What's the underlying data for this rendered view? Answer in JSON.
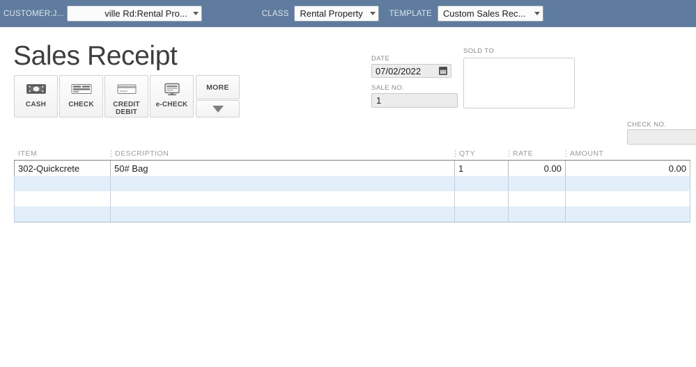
{
  "topbar": {
    "customer_label": "CUSTOMER:J...",
    "customer_value": "ville Rd:Rental Pro...",
    "class_label": "CLASS",
    "class_value": "Rental Property",
    "template_label": "TEMPLATE",
    "template_value": "Custom Sales Rec...",
    "bar_color": "#5f7c9e"
  },
  "form": {
    "title": "Sales Receipt",
    "date_label": "DATE",
    "date_value": "07/02/2022",
    "saleno_label": "SALE NO.",
    "saleno_value": "1",
    "soldto_label": "SOLD TO",
    "soldto_value": "",
    "checkno_label": "CHECK NO.",
    "checkno_value": ""
  },
  "payment_methods": [
    {
      "id": "cash",
      "label": "CASH",
      "icon": "cash-bill-icon"
    },
    {
      "id": "check",
      "label": "CHECK",
      "icon": "check-paper-icon"
    },
    {
      "id": "credit",
      "label": "CREDIT\nDEBIT",
      "icon": "credit-card-icon"
    },
    {
      "id": "echeck",
      "label": "e-CHECK",
      "icon": "monitor-icon"
    }
  ],
  "more": {
    "label": "MORE",
    "arrow_icon": "chevron-down-icon"
  },
  "line_table": {
    "columns": [
      {
        "key": "item",
        "label": "ITEM"
      },
      {
        "key": "desc",
        "label": "DESCRIPTION"
      },
      {
        "key": "qty",
        "label": "QTY"
      },
      {
        "key": "rate",
        "label": "RATE"
      },
      {
        "key": "amount",
        "label": "AMOUNT"
      }
    ],
    "rows": [
      {
        "item": "302-Quickcrete",
        "desc": "50# Bag",
        "qty": "1",
        "rate": "0.00",
        "amount": "0.00"
      },
      {
        "item": "",
        "desc": "",
        "qty": "",
        "rate": "",
        "amount": ""
      },
      {
        "item": "",
        "desc": "",
        "qty": "",
        "rate": "",
        "amount": ""
      },
      {
        "item": "",
        "desc": "",
        "qty": "",
        "rate": "",
        "amount": ""
      }
    ]
  }
}
